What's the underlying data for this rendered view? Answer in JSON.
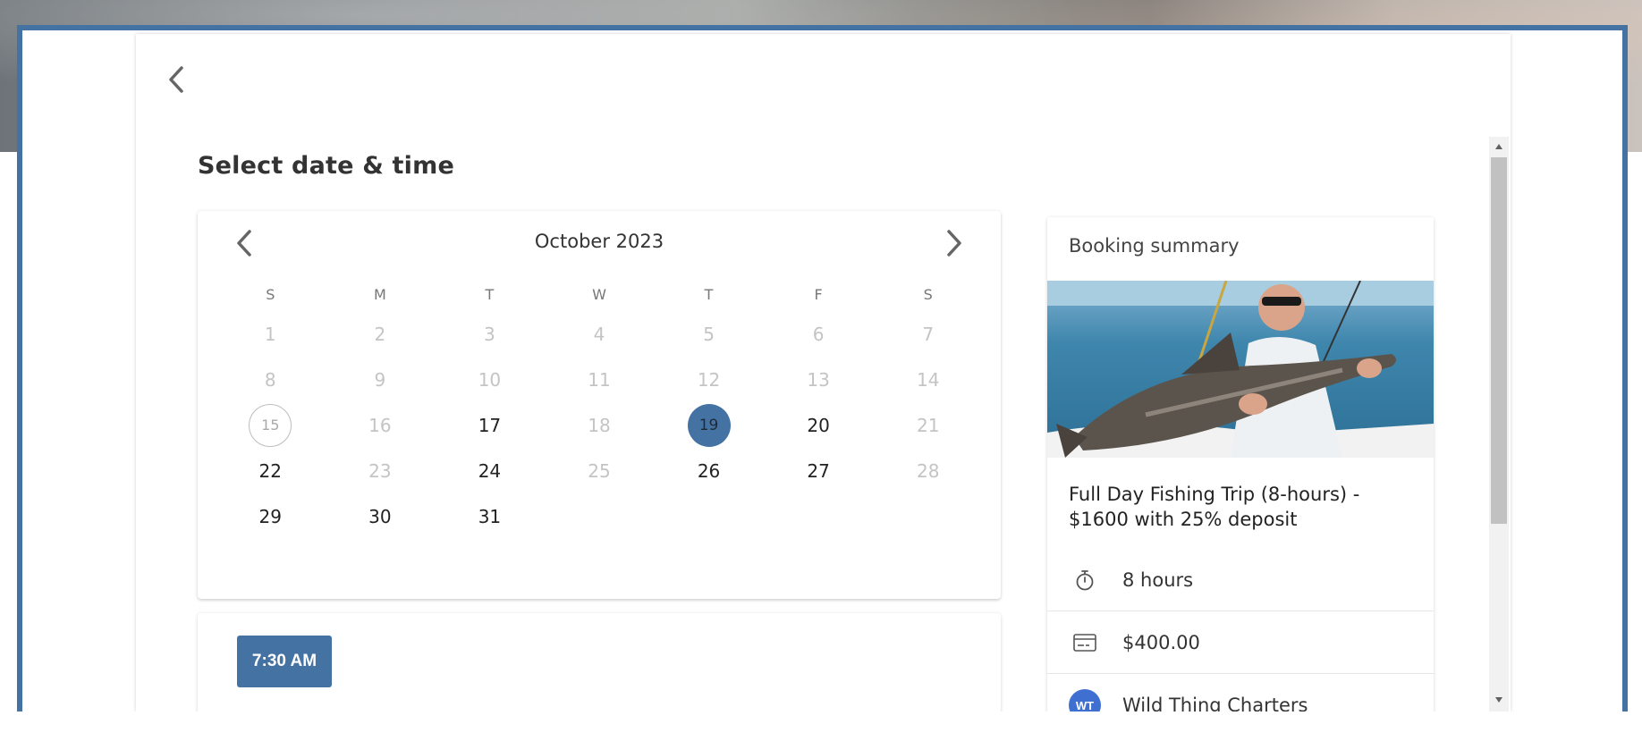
{
  "page": {
    "title": "Select date & time"
  },
  "calendar": {
    "month_label": "October 2023",
    "weekdays": [
      "S",
      "M",
      "T",
      "W",
      "T",
      "F",
      "S"
    ],
    "weeks": [
      [
        {
          "d": "1",
          "s": "disabled"
        },
        {
          "d": "2",
          "s": "disabled"
        },
        {
          "d": "3",
          "s": "disabled"
        },
        {
          "d": "4",
          "s": "disabled"
        },
        {
          "d": "5",
          "s": "disabled"
        },
        {
          "d": "6",
          "s": "disabled"
        },
        {
          "d": "7",
          "s": "disabled"
        }
      ],
      [
        {
          "d": "8",
          "s": "disabled"
        },
        {
          "d": "9",
          "s": "disabled"
        },
        {
          "d": "10",
          "s": "disabled"
        },
        {
          "d": "11",
          "s": "disabled"
        },
        {
          "d": "12",
          "s": "disabled"
        },
        {
          "d": "13",
          "s": "disabled"
        },
        {
          "d": "14",
          "s": "disabled"
        }
      ],
      [
        {
          "d": "15",
          "s": "today"
        },
        {
          "d": "16",
          "s": "disabled"
        },
        {
          "d": "17",
          "s": "available"
        },
        {
          "d": "18",
          "s": "disabled"
        },
        {
          "d": "19",
          "s": "selected"
        },
        {
          "d": "20",
          "s": "available"
        },
        {
          "d": "21",
          "s": "disabled"
        }
      ],
      [
        {
          "d": "22",
          "s": "available"
        },
        {
          "d": "23",
          "s": "disabled"
        },
        {
          "d": "24",
          "s": "available"
        },
        {
          "d": "25",
          "s": "disabled"
        },
        {
          "d": "26",
          "s": "available"
        },
        {
          "d": "27",
          "s": "available"
        },
        {
          "d": "28",
          "s": "disabled"
        }
      ],
      [
        {
          "d": "29",
          "s": "available"
        },
        {
          "d": "30",
          "s": "available"
        },
        {
          "d": "31",
          "s": "available"
        },
        {
          "d": "",
          "s": "empty"
        },
        {
          "d": "",
          "s": "empty"
        },
        {
          "d": "",
          "s": "empty"
        },
        {
          "d": "",
          "s": "empty"
        }
      ]
    ],
    "selected_color": "#4472a3"
  },
  "time_slots": {
    "items": [
      "7:30 AM"
    ]
  },
  "summary": {
    "title": "Booking summary",
    "trip_name": "Full Day Fishing Trip (8-hours) - $1600 with 25% deposit",
    "duration": "8 hours",
    "price": "$400.00",
    "organizer_initials": "WT",
    "organizer_name": "Wild Thing Charters"
  },
  "colors": {
    "accent": "#4472a3",
    "avatar": "#3f6fd0"
  }
}
